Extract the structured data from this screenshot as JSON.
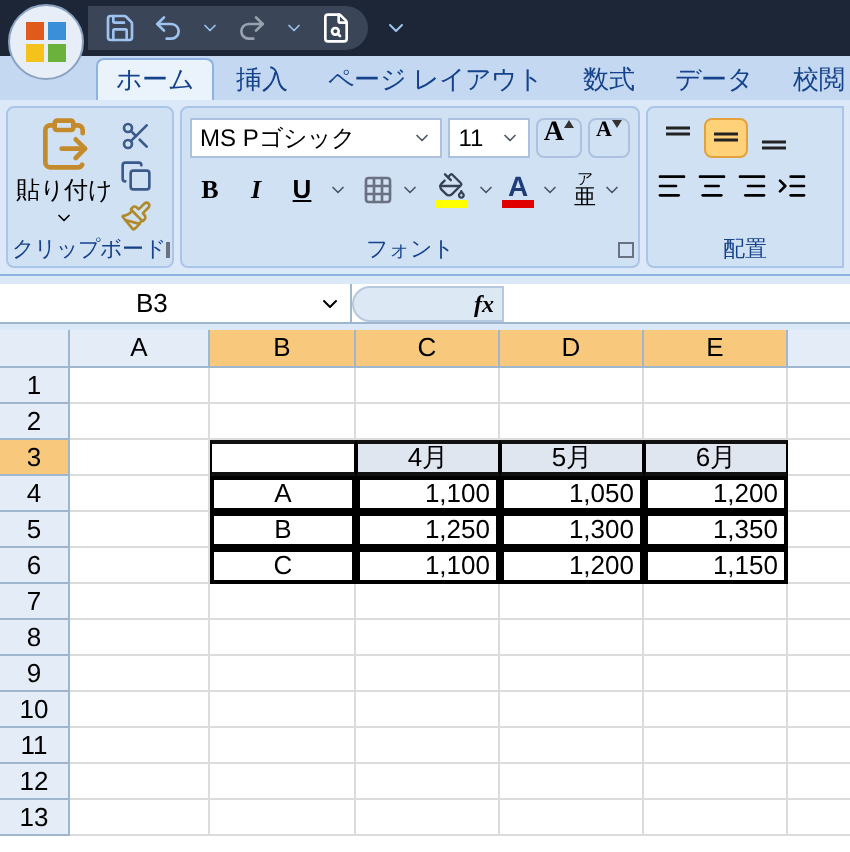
{
  "tabs": [
    {
      "label": "ホーム",
      "selected": true
    },
    {
      "label": "挿入",
      "selected": false
    },
    {
      "label": "ページ レイアウト",
      "selected": false
    },
    {
      "label": "数式",
      "selected": false
    },
    {
      "label": "データ",
      "selected": false
    },
    {
      "label": "校閲",
      "selected": false
    }
  ],
  "ribbon": {
    "clipboard": {
      "paste_label": "貼り付け",
      "group_label": "クリップボード"
    },
    "font": {
      "font_name": "MS Pゴシック",
      "font_size": "11",
      "bold": "B",
      "italic": "I",
      "underline": "U",
      "grow": "A",
      "shrink": "A",
      "font_color": "A",
      "phonetic": "亜",
      "phonetic_ruby": "ア",
      "group_label": "フォント"
    },
    "alignment": {
      "middle_align_selected": true,
      "group_label": "配置"
    }
  },
  "formula_bar": {
    "name_box": "B3",
    "fx": "fx"
  },
  "sheet": {
    "columns": [
      {
        "label": "A",
        "selected": false
      },
      {
        "label": "B",
        "selected": true
      },
      {
        "label": "C",
        "selected": true
      },
      {
        "label": "D",
        "selected": true
      },
      {
        "label": "E",
        "selected": true
      }
    ],
    "rows": [
      {
        "label": "1",
        "selected": false
      },
      {
        "label": "2",
        "selected": false
      },
      {
        "label": "3",
        "selected": true,
        "cells": [
          {
            "kind": "empty",
            "selected": false
          },
          {
            "kind": "header",
            "selected": true,
            "active": true
          },
          {
            "kind": "header",
            "text": "4月",
            "selected": true
          },
          {
            "kind": "header",
            "text": "5月",
            "selected": true
          },
          {
            "kind": "header",
            "text": "6月",
            "selected": true
          }
        ]
      },
      {
        "label": "4",
        "selected": false,
        "cells": [
          {
            "kind": "empty",
            "selected": false
          },
          {
            "kind": "label",
            "text": "A",
            "selected": false
          },
          {
            "kind": "number",
            "text": "1,100",
            "selected": false
          },
          {
            "kind": "number",
            "text": "1,050",
            "selected": false
          },
          {
            "kind": "number",
            "text": "1,200",
            "selected": false
          }
        ]
      },
      {
        "label": "5",
        "selected": false,
        "cells": [
          {
            "kind": "empty",
            "selected": false
          },
          {
            "kind": "label",
            "text": "B",
            "selected": false
          },
          {
            "kind": "number",
            "text": "1,250",
            "selected": false
          },
          {
            "kind": "number",
            "text": "1,300",
            "selected": false
          },
          {
            "kind": "number",
            "text": "1,350",
            "selected": false
          }
        ]
      },
      {
        "label": "6",
        "selected": false,
        "cells": [
          {
            "kind": "empty",
            "selected": false
          },
          {
            "kind": "label",
            "text": "C",
            "selected": false
          },
          {
            "kind": "number",
            "text": "1,100",
            "selected": false
          },
          {
            "kind": "number",
            "text": "1,200",
            "selected": false
          },
          {
            "kind": "number",
            "text": "1,150",
            "selected": false
          }
        ]
      },
      {
        "label": "7",
        "selected": false
      },
      {
        "label": "8",
        "selected": false
      },
      {
        "label": "9",
        "selected": false
      },
      {
        "label": "10",
        "selected": false
      },
      {
        "label": "11",
        "selected": false
      },
      {
        "label": "12",
        "selected": false
      },
      {
        "label": "13",
        "selected": false
      }
    ]
  }
}
